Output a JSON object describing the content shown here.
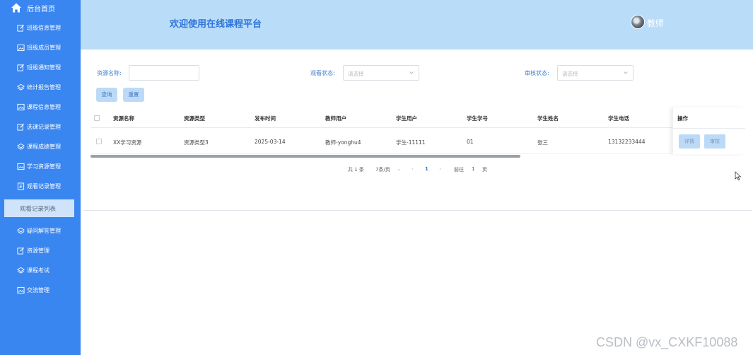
{
  "sidebar": {
    "home_label": "后台首页",
    "items": [
      {
        "label": "班级信息管理",
        "icon": "edit-icon"
      },
      {
        "label": "班级成员管理",
        "icon": "image-icon"
      },
      {
        "label": "班级通知管理",
        "icon": "edit-icon"
      },
      {
        "label": "统计报告管理",
        "icon": "layers-icon"
      },
      {
        "label": "课程信息管理",
        "icon": "image-icon"
      },
      {
        "label": "选课记录管理",
        "icon": "edit-icon"
      },
      {
        "label": "课程成绩管理",
        "icon": "layers-icon"
      },
      {
        "label": "学习资源管理",
        "icon": "image-icon"
      },
      {
        "label": "观看记录管理",
        "icon": "document-icon"
      },
      {
        "label": "疑问解答管理",
        "icon": "layers-icon"
      },
      {
        "label": "资源管理",
        "icon": "edit-icon"
      },
      {
        "label": "课程考试",
        "icon": "layers-icon"
      },
      {
        "label": "交流管理",
        "icon": "image-icon"
      }
    ],
    "active_sub_label": "观看记录列表"
  },
  "header": {
    "title": "欢迎使用在线课程平台",
    "user_name": "教师"
  },
  "search": {
    "resource_name_label": "资源名称:",
    "resource_name_value": "",
    "watch_status_label": "观看状态:",
    "watch_status_placeholder": "请选择",
    "review_status_label": "审核状态:",
    "review_status_placeholder": "请选择",
    "query_button": "查询",
    "reset_button": "重置"
  },
  "table": {
    "columns": [
      "资源名称",
      "资源类型",
      "发布时间",
      "教师用户",
      "学生用户",
      "学生学号",
      "学生姓名",
      "学生电话"
    ],
    "action_column": "操作",
    "rows": [
      {
        "cells": [
          "XX学习资源",
          "资源类型3",
          "2025-03-14",
          "教师-yonghu4",
          "学生-11111",
          "01",
          "张三",
          "13132233444"
        ],
        "detail_button": "详情",
        "review_button": "审核"
      }
    ]
  },
  "pagination": {
    "total": "共 1 条",
    "page_size": "7条/页",
    "current_page": "1",
    "goto_label": "前往",
    "goto_value": "1",
    "page_suffix": "页"
  },
  "watermark": "CSDN @vx_CXKF10088",
  "colors": {
    "sidebar_bg": "#3a86f0",
    "header_bg": "#b9dcf9",
    "accent": "#2f74d8",
    "button_bg": "#bcdaf7"
  }
}
